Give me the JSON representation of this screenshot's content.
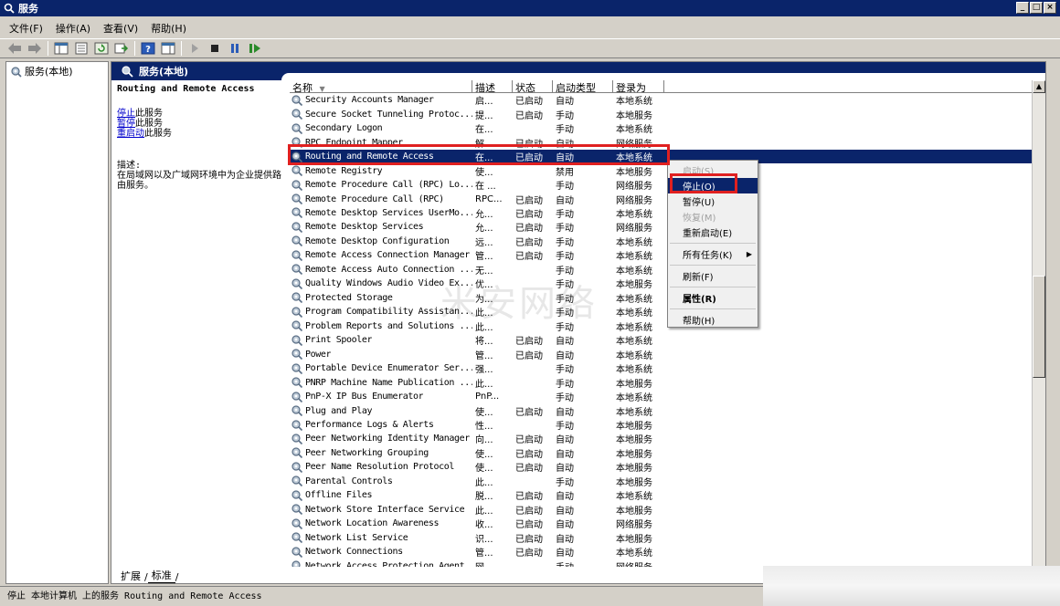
{
  "window": {
    "title": "服务"
  },
  "menu": [
    "文件(F)",
    "操作(A)",
    "查看(V)",
    "帮助(H)"
  ],
  "toolbar": {
    "icons": [
      "back-arrow-icon",
      "forward-arrow-icon",
      "show-console-tree-icon",
      "properties-icon",
      "refresh-icon",
      "export-list-icon",
      "help-icon",
      "show-hide-action-pane-icon",
      "start-icon",
      "stop-icon",
      "pause-icon",
      "restart-icon"
    ]
  },
  "tree": {
    "root_label": "服务(本地)"
  },
  "pane": {
    "header": "服务(本地)",
    "selected_service": "Routing and Remote Access",
    "links": [
      {
        "link": "停止",
        "rest": "此服务"
      },
      {
        "link": "暂停",
        "rest": "此服务"
      },
      {
        "link": "重启动",
        "rest": "此服务"
      }
    ],
    "desc_label": "描述:",
    "desc_text": "在局域网以及广域网环境中为企业提供路由服务。"
  },
  "columns": [
    "名称",
    "描述",
    "状态",
    "启动类型",
    "登录为"
  ],
  "rows": [
    {
      "name": "Security Accounts Manager",
      "desc": "启...",
      "status": "已启动",
      "start": "自动",
      "logon": "本地系统"
    },
    {
      "name": "Secure Socket Tunneling Protoc...",
      "desc": "提...",
      "status": "已启动",
      "start": "手动",
      "logon": "本地服务"
    },
    {
      "name": "Secondary Logon",
      "desc": "在...",
      "status": "",
      "start": "手动",
      "logon": "本地系统"
    },
    {
      "name": "RPC Endpoint Mapper",
      "desc": "解...",
      "status": "已启动",
      "start": "自动",
      "logon": "网络服务"
    },
    {
      "name": "Routing and Remote Access",
      "desc": "在...",
      "status": "已启动",
      "start": "自动",
      "logon": "本地系统",
      "selected": true
    },
    {
      "name": "Remote Registry",
      "desc": "使...",
      "status": "",
      "start": "禁用",
      "logon": "本地服务"
    },
    {
      "name": "Remote Procedure Call (RPC) Lo...",
      "desc": "在 ...",
      "status": "",
      "start": "手动",
      "logon": "网络服务"
    },
    {
      "name": "Remote Procedure Call (RPC)",
      "desc": "RPC...",
      "status": "已启动",
      "start": "自动",
      "logon": "网络服务"
    },
    {
      "name": "Remote Desktop Services UserMo...",
      "desc": "允...",
      "status": "已启动",
      "start": "手动",
      "logon": "本地系统"
    },
    {
      "name": "Remote Desktop Services",
      "desc": "允...",
      "status": "已启动",
      "start": "手动",
      "logon": "网络服务"
    },
    {
      "name": "Remote Desktop Configuration",
      "desc": "远...",
      "status": "已启动",
      "start": "手动",
      "logon": "本地系统"
    },
    {
      "name": "Remote Access Connection Manager",
      "desc": "管...",
      "status": "已启动",
      "start": "手动",
      "logon": "本地系统"
    },
    {
      "name": "Remote Access Auto Connection ...",
      "desc": "无...",
      "status": "",
      "start": "手动",
      "logon": "本地系统"
    },
    {
      "name": "Quality Windows Audio Video Ex...",
      "desc": "优...",
      "status": "",
      "start": "手动",
      "logon": "本地服务"
    },
    {
      "name": "Protected Storage",
      "desc": "为...",
      "status": "",
      "start": "手动",
      "logon": "本地系统"
    },
    {
      "name": "Program Compatibility Assistan...",
      "desc": "此...",
      "status": "",
      "start": "手动",
      "logon": "本地系统"
    },
    {
      "name": "Problem Reports and Solutions ...",
      "desc": "此...",
      "status": "",
      "start": "手动",
      "logon": "本地系统"
    },
    {
      "name": "Print Spooler",
      "desc": "将...",
      "status": "已启动",
      "start": "自动",
      "logon": "本地系统"
    },
    {
      "name": "Power",
      "desc": "管...",
      "status": "已启动",
      "start": "自动",
      "logon": "本地系统"
    },
    {
      "name": "Portable Device Enumerator Ser...",
      "desc": "强...",
      "status": "",
      "start": "手动",
      "logon": "本地系统"
    },
    {
      "name": "PNRP Machine Name Publication ...",
      "desc": "此...",
      "status": "",
      "start": "手动",
      "logon": "本地服务"
    },
    {
      "name": "PnP-X IP Bus Enumerator",
      "desc": "PnP...",
      "status": "",
      "start": "手动",
      "logon": "本地系统"
    },
    {
      "name": "Plug and Play",
      "desc": "使...",
      "status": "已启动",
      "start": "自动",
      "logon": "本地系统"
    },
    {
      "name": "Performance Logs & Alerts",
      "desc": "性...",
      "status": "",
      "start": "手动",
      "logon": "本地服务"
    },
    {
      "name": "Peer Networking Identity Manager",
      "desc": "向...",
      "status": "已启动",
      "start": "自动",
      "logon": "本地服务"
    },
    {
      "name": "Peer Networking Grouping",
      "desc": "使...",
      "status": "已启动",
      "start": "自动",
      "logon": "本地服务"
    },
    {
      "name": "Peer Name Resolution Protocol",
      "desc": "使...",
      "status": "已启动",
      "start": "自动",
      "logon": "本地服务"
    },
    {
      "name": "Parental Controls",
      "desc": "此...",
      "status": "",
      "start": "手动",
      "logon": "本地服务"
    },
    {
      "name": "Offline Files",
      "desc": "脱...",
      "status": "已启动",
      "start": "自动",
      "logon": "本地系统"
    },
    {
      "name": "Network Store Interface Service",
      "desc": "此...",
      "status": "已启动",
      "start": "自动",
      "logon": "本地服务"
    },
    {
      "name": "Network Location Awareness",
      "desc": "收...",
      "status": "已启动",
      "start": "自动",
      "logon": "网络服务"
    },
    {
      "name": "Network List Service",
      "desc": "识...",
      "status": "已启动",
      "start": "自动",
      "logon": "本地服务"
    },
    {
      "name": "Network Connections",
      "desc": "管...",
      "status": "已启动",
      "start": "自动",
      "logon": "本地系统"
    },
    {
      "name": "Network Access Protection Agent",
      "desc": "网...",
      "status": "",
      "start": "手动",
      "logon": "网络服务"
    }
  ],
  "context_menu": [
    {
      "label": "启动(S)",
      "state": "disabled"
    },
    {
      "label": "停止(O)",
      "state": "selected"
    },
    {
      "label": "暂停(U)",
      "state": "normal"
    },
    {
      "label": "恢复(M)",
      "state": "disabled"
    },
    {
      "label": "重新启动(E)",
      "state": "normal"
    },
    {
      "sep": true
    },
    {
      "label": "所有任务(K)",
      "state": "normal",
      "submenu": true
    },
    {
      "sep": true
    },
    {
      "label": "刷新(F)",
      "state": "normal"
    },
    {
      "sep": true
    },
    {
      "label": "属性(R)",
      "state": "bold"
    },
    {
      "sep": true
    },
    {
      "label": "帮助(H)",
      "state": "normal"
    }
  ],
  "tabs": [
    "扩展",
    "标准"
  ],
  "statusbar": "停止 本地计算机 上的服务 Routing and Remote Access",
  "watermark": "米安网络",
  "colors": {
    "title_bg": "#0a246a",
    "highlight_red": "#e02020",
    "window_bg": "#d4d0c8"
  }
}
